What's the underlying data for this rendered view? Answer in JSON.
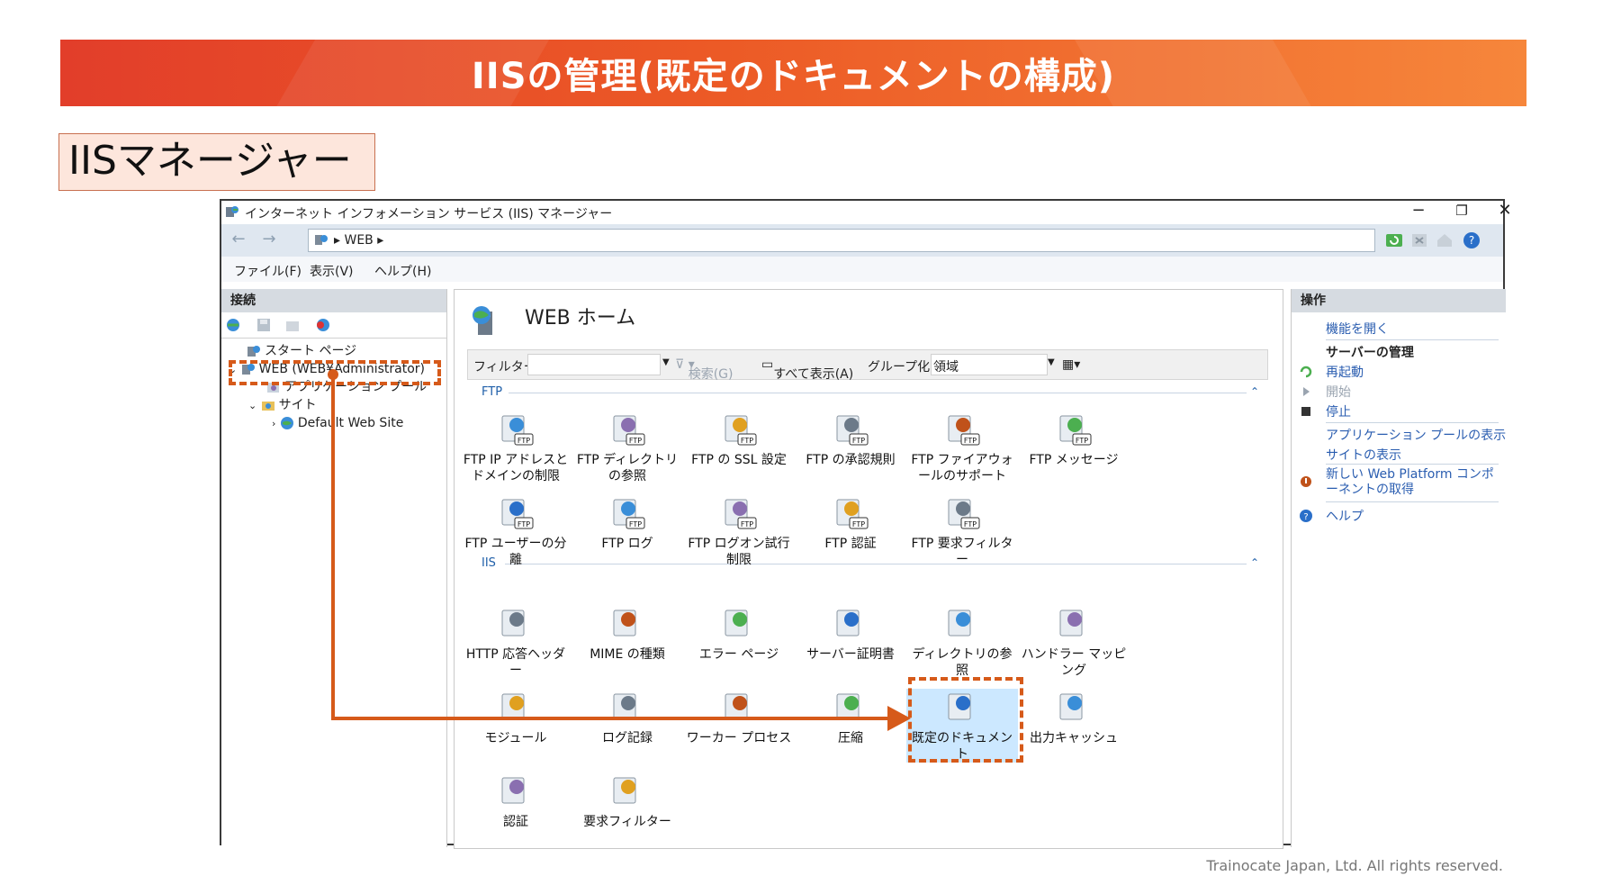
{
  "slide": {
    "title": "IISの管理(既定のドキュメントの構成)",
    "label": "IISマネージャー",
    "footer": "Trainocate Japan, Ltd. All rights reserved.",
    "accent_color": "#d65a1a"
  },
  "window": {
    "title": "インターネット インフォメーション サービス (IIS) マネージャー",
    "controls": {
      "minimize": "−",
      "restore": "❐",
      "close": "✕"
    },
    "address": {
      "crumb": "WEB"
    },
    "menu": [
      "ファイル(F)",
      "表示(V)",
      "ヘルプ(H)"
    ]
  },
  "connections": {
    "header": "接続",
    "tree": [
      {
        "label": "スタート ページ",
        "icon": "start-page-icon"
      },
      {
        "label": "WEB (WEB¥Administrator)",
        "icon": "server-icon"
      },
      {
        "label": "アプリケーション プール",
        "icon": "app-pool-icon"
      },
      {
        "label": "サイト",
        "icon": "sites-folder-icon"
      },
      {
        "label": "Default Web Site",
        "icon": "globe-icon"
      }
    ]
  },
  "home": {
    "title": "WEB ホーム",
    "filter_label": "フィルター:",
    "search": "検索(G)",
    "show_all": "すべて表示(A)",
    "group_by_label": "グループ化:",
    "group_by_value": "領域",
    "groups": [
      {
        "name": "FTP",
        "features": [
          "FTP IP アドレスとドメインの制限",
          "FTP ディレクトリの参照",
          "FTP の SSL 設定",
          "FTP の承認規則",
          "FTP ファイアウォールのサポート",
          "FTP メッセージ",
          "FTP ユーザーの分離",
          "FTP ログ",
          "FTP ログオン試行制限",
          "FTP 認証",
          "FTP 要求フィルター"
        ]
      },
      {
        "name": "IIS",
        "features": [
          "HTTP 応答ヘッダー",
          "MIME の種類",
          "エラー ページ",
          "サーバー証明書",
          "ディレクトリの参照",
          "ハンドラー マッピング",
          "モジュール",
          "ログ記録",
          "ワーカー プロセス",
          "圧縮",
          "既定のドキュメント",
          "出力キャッシュ",
          "認証",
          "要求フィルター"
        ]
      }
    ]
  },
  "actions": {
    "header": "操作",
    "open_feature": "機能を開く",
    "manage_server": "サーバーの管理",
    "restart": "再起動",
    "start": "開始",
    "stop": "停止",
    "view_app_pools": "アプリケーション プールの表示",
    "view_sites": "サイトの表示",
    "web_platform": "新しい Web Platform コンポーネントの取得",
    "help": "ヘルプ"
  }
}
